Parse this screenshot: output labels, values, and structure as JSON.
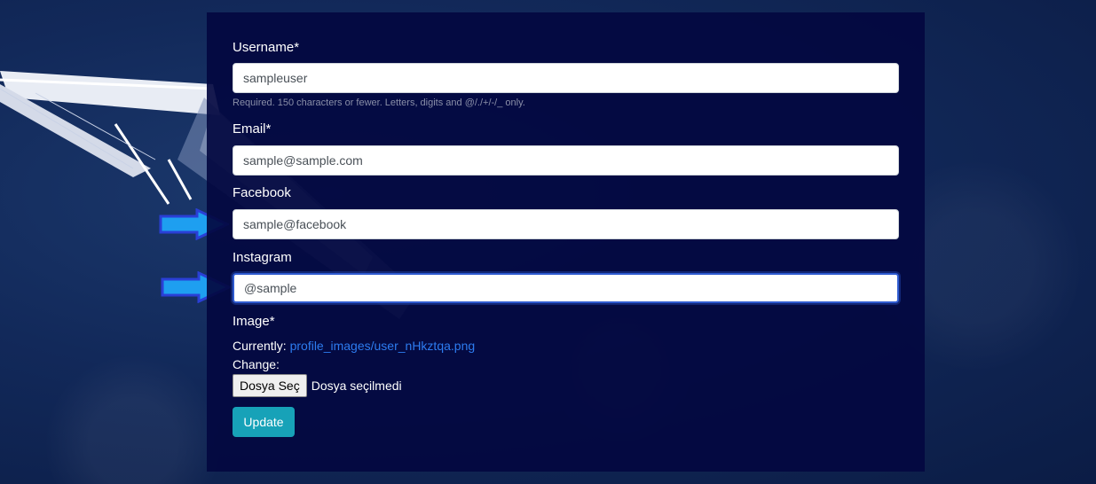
{
  "form": {
    "username": {
      "label": "Username*",
      "value": "sampleuser",
      "help": "Required. 150 characters or fewer. Letters, digits and @/./+/-/_ only."
    },
    "email": {
      "label": "Email*",
      "value": "sample@sample.com"
    },
    "facebook": {
      "label": "Facebook",
      "value": "sample@facebook"
    },
    "instagram": {
      "label": "Instagram",
      "value": "@sample"
    },
    "image": {
      "label": "Image*",
      "currently_label": "Currently:",
      "current_file": "profile_images/user_nHkztqa.png",
      "change_label": "Change:",
      "choose_button": "Dosya Seç",
      "no_file_text": "Dosya seçilmedi"
    },
    "submit_label": "Update"
  },
  "colors": {
    "panel": "#030840",
    "button": "#17a2b8",
    "link": "#2d7cf0",
    "arrow_fill": "#1e9ff0",
    "arrow_border": "#2a3fd6"
  },
  "icons": {
    "annotation": "right-arrow-icon"
  }
}
